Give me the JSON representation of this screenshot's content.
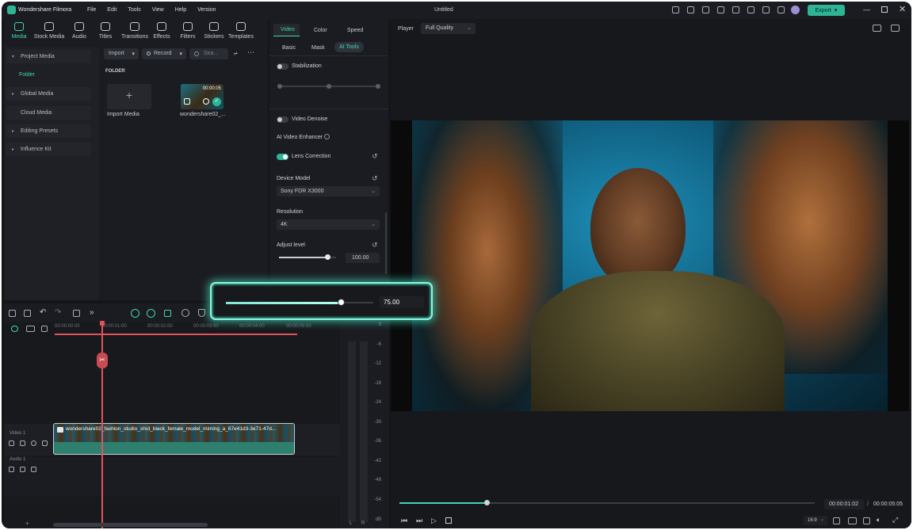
{
  "app": {
    "name": "Wondershare Filmora",
    "window_title": "Untitled",
    "menu": [
      "File",
      "Edit",
      "Tools",
      "View",
      "Help",
      "Version"
    ],
    "export_label": "Export"
  },
  "toolbar": {
    "tabs": [
      "Media",
      "Stock Media",
      "Audio",
      "Titles",
      "Transitions",
      "Effects",
      "Filters",
      "Stickers",
      "Templates"
    ]
  },
  "sidebar": {
    "items": [
      "Project Media",
      "Folder",
      "Global Media",
      "Cloud Media",
      "Editing Presets",
      "Influence Kit"
    ]
  },
  "media": {
    "import_label": "Import",
    "record_label": "Record",
    "search_placeholder": "Sea...",
    "folder_heading": "FOLDER",
    "import_media_label": "Import Media",
    "clip_name": "wondershare02_...",
    "clip_duration": "00:00:05"
  },
  "properties": {
    "tabs": [
      "Video",
      "Color",
      "Speed"
    ],
    "subtabs": [
      "Basic",
      "Mask",
      "AI Tools"
    ],
    "stabilization_label": "Stabilization",
    "video_denoise_label": "Video Denoise",
    "ai_enhancer_label": "AI Video Enhancer",
    "lens_correction_label": "Lens Correction",
    "device_model_label": "Device Model",
    "device_model_value": "Sony FDR X3000",
    "resolution_label": "Resolution",
    "resolution_value": "4K",
    "adjust_level_label": "Adjust level",
    "adjust_level_value": "100.00",
    "adjust_level_fraction": 0.85
  },
  "zoom_callout": {
    "value": "75.00",
    "fraction": 0.78
  },
  "player": {
    "label": "Player",
    "quality": "Full Quality",
    "current_time": "00:00:01:02",
    "total_time": "00:00:05:05",
    "aspect": "16:9",
    "progress_fraction": 0.21
  },
  "timeline": {
    "ruler": [
      "00:00:00:00",
      "00:00:01:00",
      "00:00:02:00",
      "00:00:03:00",
      "00:00:04:00",
      "00:00:05:00"
    ],
    "video_track_label": "Video 1",
    "audio_track_label": "Audio 1",
    "clip_title": "wondershare02_fashion_studio_shot_black_female_model_miming_a_67e41d3-3e71-47d..."
  },
  "meter": {
    "labels": [
      "0",
      "-6",
      "-12",
      "-18",
      "-24",
      "-30",
      "-36",
      "-42",
      "-48",
      "-54",
      "dB"
    ],
    "channels": [
      "L",
      "R"
    ]
  },
  "colors": {
    "accent": "#3fd6b6",
    "export_button": "#2fb596",
    "playhead": "#e2525c",
    "clip_audio": "#2f7f6f"
  }
}
